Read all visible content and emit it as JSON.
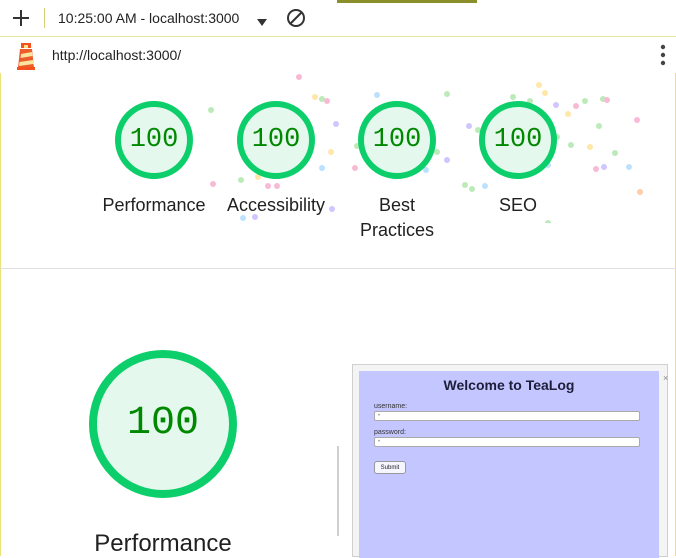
{
  "toolbar": {
    "time_label": "10:25:00 AM - localhost:3000",
    "icons": [
      "plus-icon",
      "chevron-down-icon",
      "block-icon"
    ]
  },
  "urlbar": {
    "url": "http://localhost:3000/",
    "icons": [
      "lighthouse-icon",
      "more-vert-icon"
    ]
  },
  "scores": [
    {
      "value": "100",
      "label": "Performance"
    },
    {
      "value": "100",
      "label": "Accessibility"
    },
    {
      "value": "100",
      "label": "Best Practices"
    },
    {
      "value": "100",
      "label": "SEO"
    }
  ],
  "main": {
    "score": "100",
    "label": "Performance"
  },
  "preview": {
    "title": "Welcome to TeaLog",
    "username_label": "username:",
    "password_label": "password:",
    "submit_label": "Submit"
  },
  "colors": {
    "pass": "#0cce6b",
    "pass_fill": "#e5f8ed",
    "pass_text": "#008800",
    "preview_bg": "#c4c7ff"
  }
}
